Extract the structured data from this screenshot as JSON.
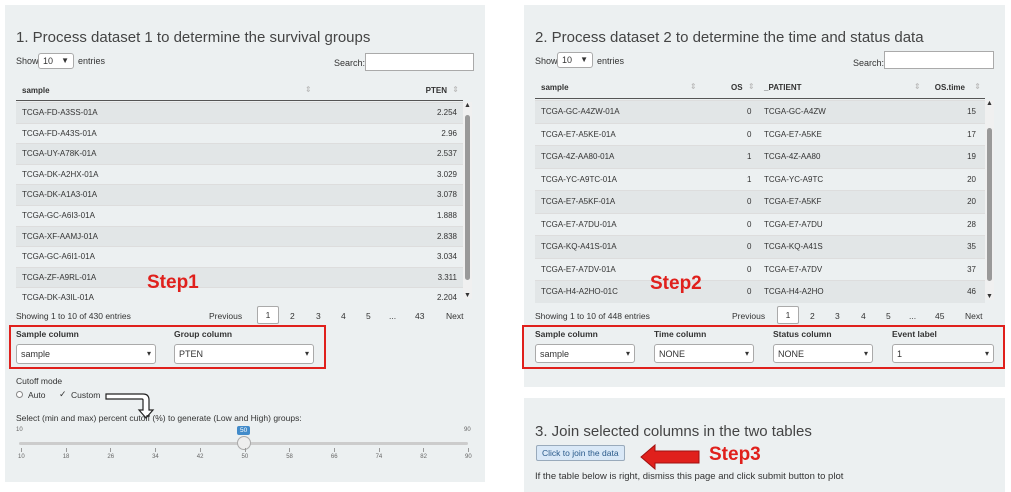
{
  "panel1": {
    "title": "1. Process dataset 1 to determine the survival groups",
    "show_label": "Show",
    "entries_value": "10",
    "entries_label": "entries",
    "search_label": "Search:",
    "columns": [
      "sample",
      "PTEN"
    ],
    "rows": [
      [
        "TCGA-FD-A3SS-01A",
        "2.254"
      ],
      [
        "TCGA-FD-A43S-01A",
        "2.96"
      ],
      [
        "TCGA-UY-A78K-01A",
        "2.537"
      ],
      [
        "TCGA-DK-A2HX-01A",
        "3.029"
      ],
      [
        "TCGA-DK-A1A3-01A",
        "3.078"
      ],
      [
        "TCGA-GC-A6I3-01A",
        "1.888"
      ],
      [
        "TCGA-XF-AAMJ-01A",
        "2.838"
      ],
      [
        "TCGA-GC-A6I1-01A",
        "3.034"
      ],
      [
        "TCGA-ZF-A9RL-01A",
        "3.311"
      ],
      [
        "TCGA-DK-A3IL-01A",
        "2.204"
      ]
    ],
    "info": "Showing 1 to 10 of 430 entries",
    "pager": {
      "previous": "Previous",
      "pages": [
        "1",
        "2",
        "3",
        "4",
        "5",
        "...",
        "43"
      ],
      "next": "Next"
    },
    "sample_column_label": "Sample column",
    "sample_column_value": "sample",
    "group_column_label": "Group column",
    "group_column_value": "PTEN",
    "cutoff_mode_label": "Cutoff mode",
    "cutoff_auto": "Auto",
    "cutoff_custom": "Custom",
    "slider_label": "Select (min and max) percent cutoff (%) to generate (Low and High) groups:",
    "slider_min": "10",
    "slider_max": "90",
    "slider_value": "50",
    "slider_ticks": [
      "10",
      "18",
      "26",
      "34",
      "42",
      "50",
      "58",
      "66",
      "74",
      "82",
      "90"
    ]
  },
  "panel2": {
    "title": "2. Process dataset 2 to determine the time and status data",
    "show_label": "Show",
    "entries_value": "10",
    "entries_label": "entries",
    "search_label": "Search:",
    "columns": [
      "sample",
      "OS",
      "_PATIENT",
      "OS.time"
    ],
    "rows": [
      [
        "TCGA-GC-A4ZW-01A",
        "0",
        "TCGA-GC-A4ZW",
        "15"
      ],
      [
        "TCGA-E7-A5KE-01A",
        "0",
        "TCGA-E7-A5KE",
        "17"
      ],
      [
        "TCGA-4Z-AA80-01A",
        "1",
        "TCGA-4Z-AA80",
        "19"
      ],
      [
        "TCGA-YC-A9TC-01A",
        "1",
        "TCGA-YC-A9TC",
        "20"
      ],
      [
        "TCGA-E7-A5KF-01A",
        "0",
        "TCGA-E7-A5KF",
        "20"
      ],
      [
        "TCGA-E7-A7DU-01A",
        "0",
        "TCGA-E7-A7DU",
        "28"
      ],
      [
        "TCGA-KQ-A41S-01A",
        "0",
        "TCGA-KQ-A41S",
        "35"
      ],
      [
        "TCGA-E7-A7DV-01A",
        "0",
        "TCGA-E7-A7DV",
        "37"
      ],
      [
        "TCGA-H4-A2HO-01C",
        "0",
        "TCGA-H4-A2HO",
        "46"
      ]
    ],
    "info": "Showing 1 to 10 of 448 entries",
    "pager": {
      "previous": "Previous",
      "pages": [
        "1",
        "2",
        "3",
        "4",
        "5",
        "...",
        "45"
      ],
      "next": "Next"
    },
    "sample_column_label": "Sample column",
    "sample_column_value": "sample",
    "time_column_label": "Time column",
    "time_column_value": "NONE",
    "status_column_label": "Status column",
    "status_column_value": "NONE",
    "event_label_label": "Event label",
    "event_label_value": "1"
  },
  "panel3": {
    "title": "3. Join selected columns in the two tables",
    "button": "Click to join the data",
    "note": "If the table below is right, dismiss this page and click submit button to plot"
  },
  "annotations": {
    "step1": "Step1",
    "step2": "Step2",
    "step3": "Step3",
    "color": "#e0201c"
  }
}
